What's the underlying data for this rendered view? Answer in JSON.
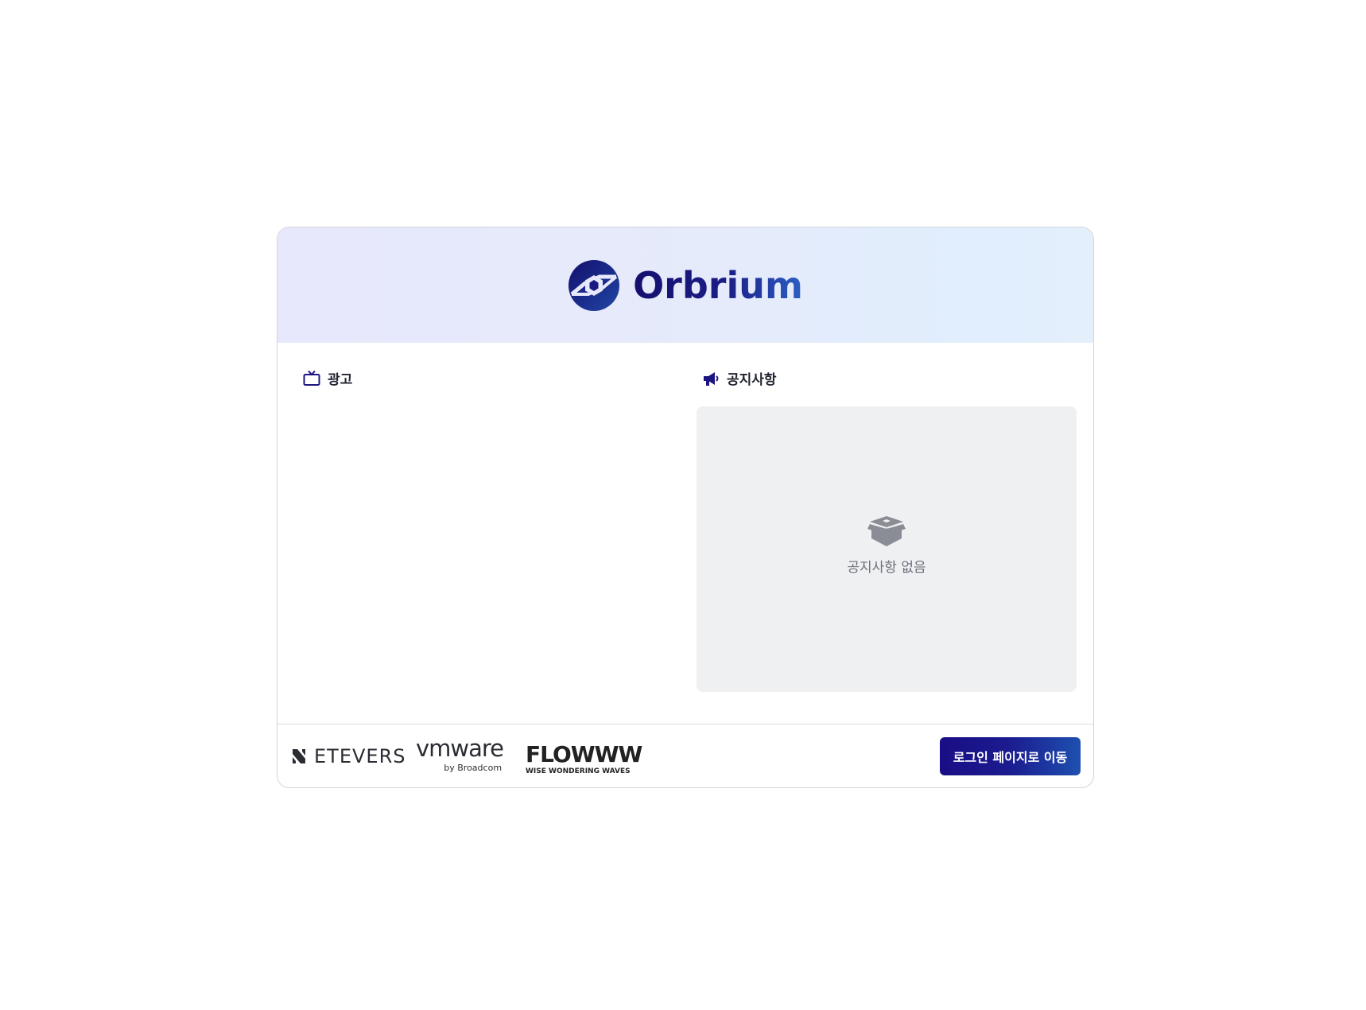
{
  "brand": {
    "name": "Orbrium",
    "logo_icon": "orbrium-logo-icon"
  },
  "sections": {
    "ad": {
      "label": "광고",
      "icon": "tv-icon"
    },
    "notice": {
      "label": "공지사항",
      "icon": "megaphone-icon",
      "empty_text": "공지사항 없음",
      "empty_icon": "open-box-icon"
    }
  },
  "footer": {
    "partners": [
      {
        "name": "ETEVERS"
      },
      {
        "name": "vmware",
        "sub": "by Broadcom"
      },
      {
        "name": "FLOWWW",
        "sub": "WISE WONDERING WAVES"
      }
    ],
    "login_button": "로그인 페이지로 이동"
  },
  "colors": {
    "primary": "#1a0d86",
    "accent": "#2c5fc3",
    "notice_bg": "#eff0f2"
  }
}
